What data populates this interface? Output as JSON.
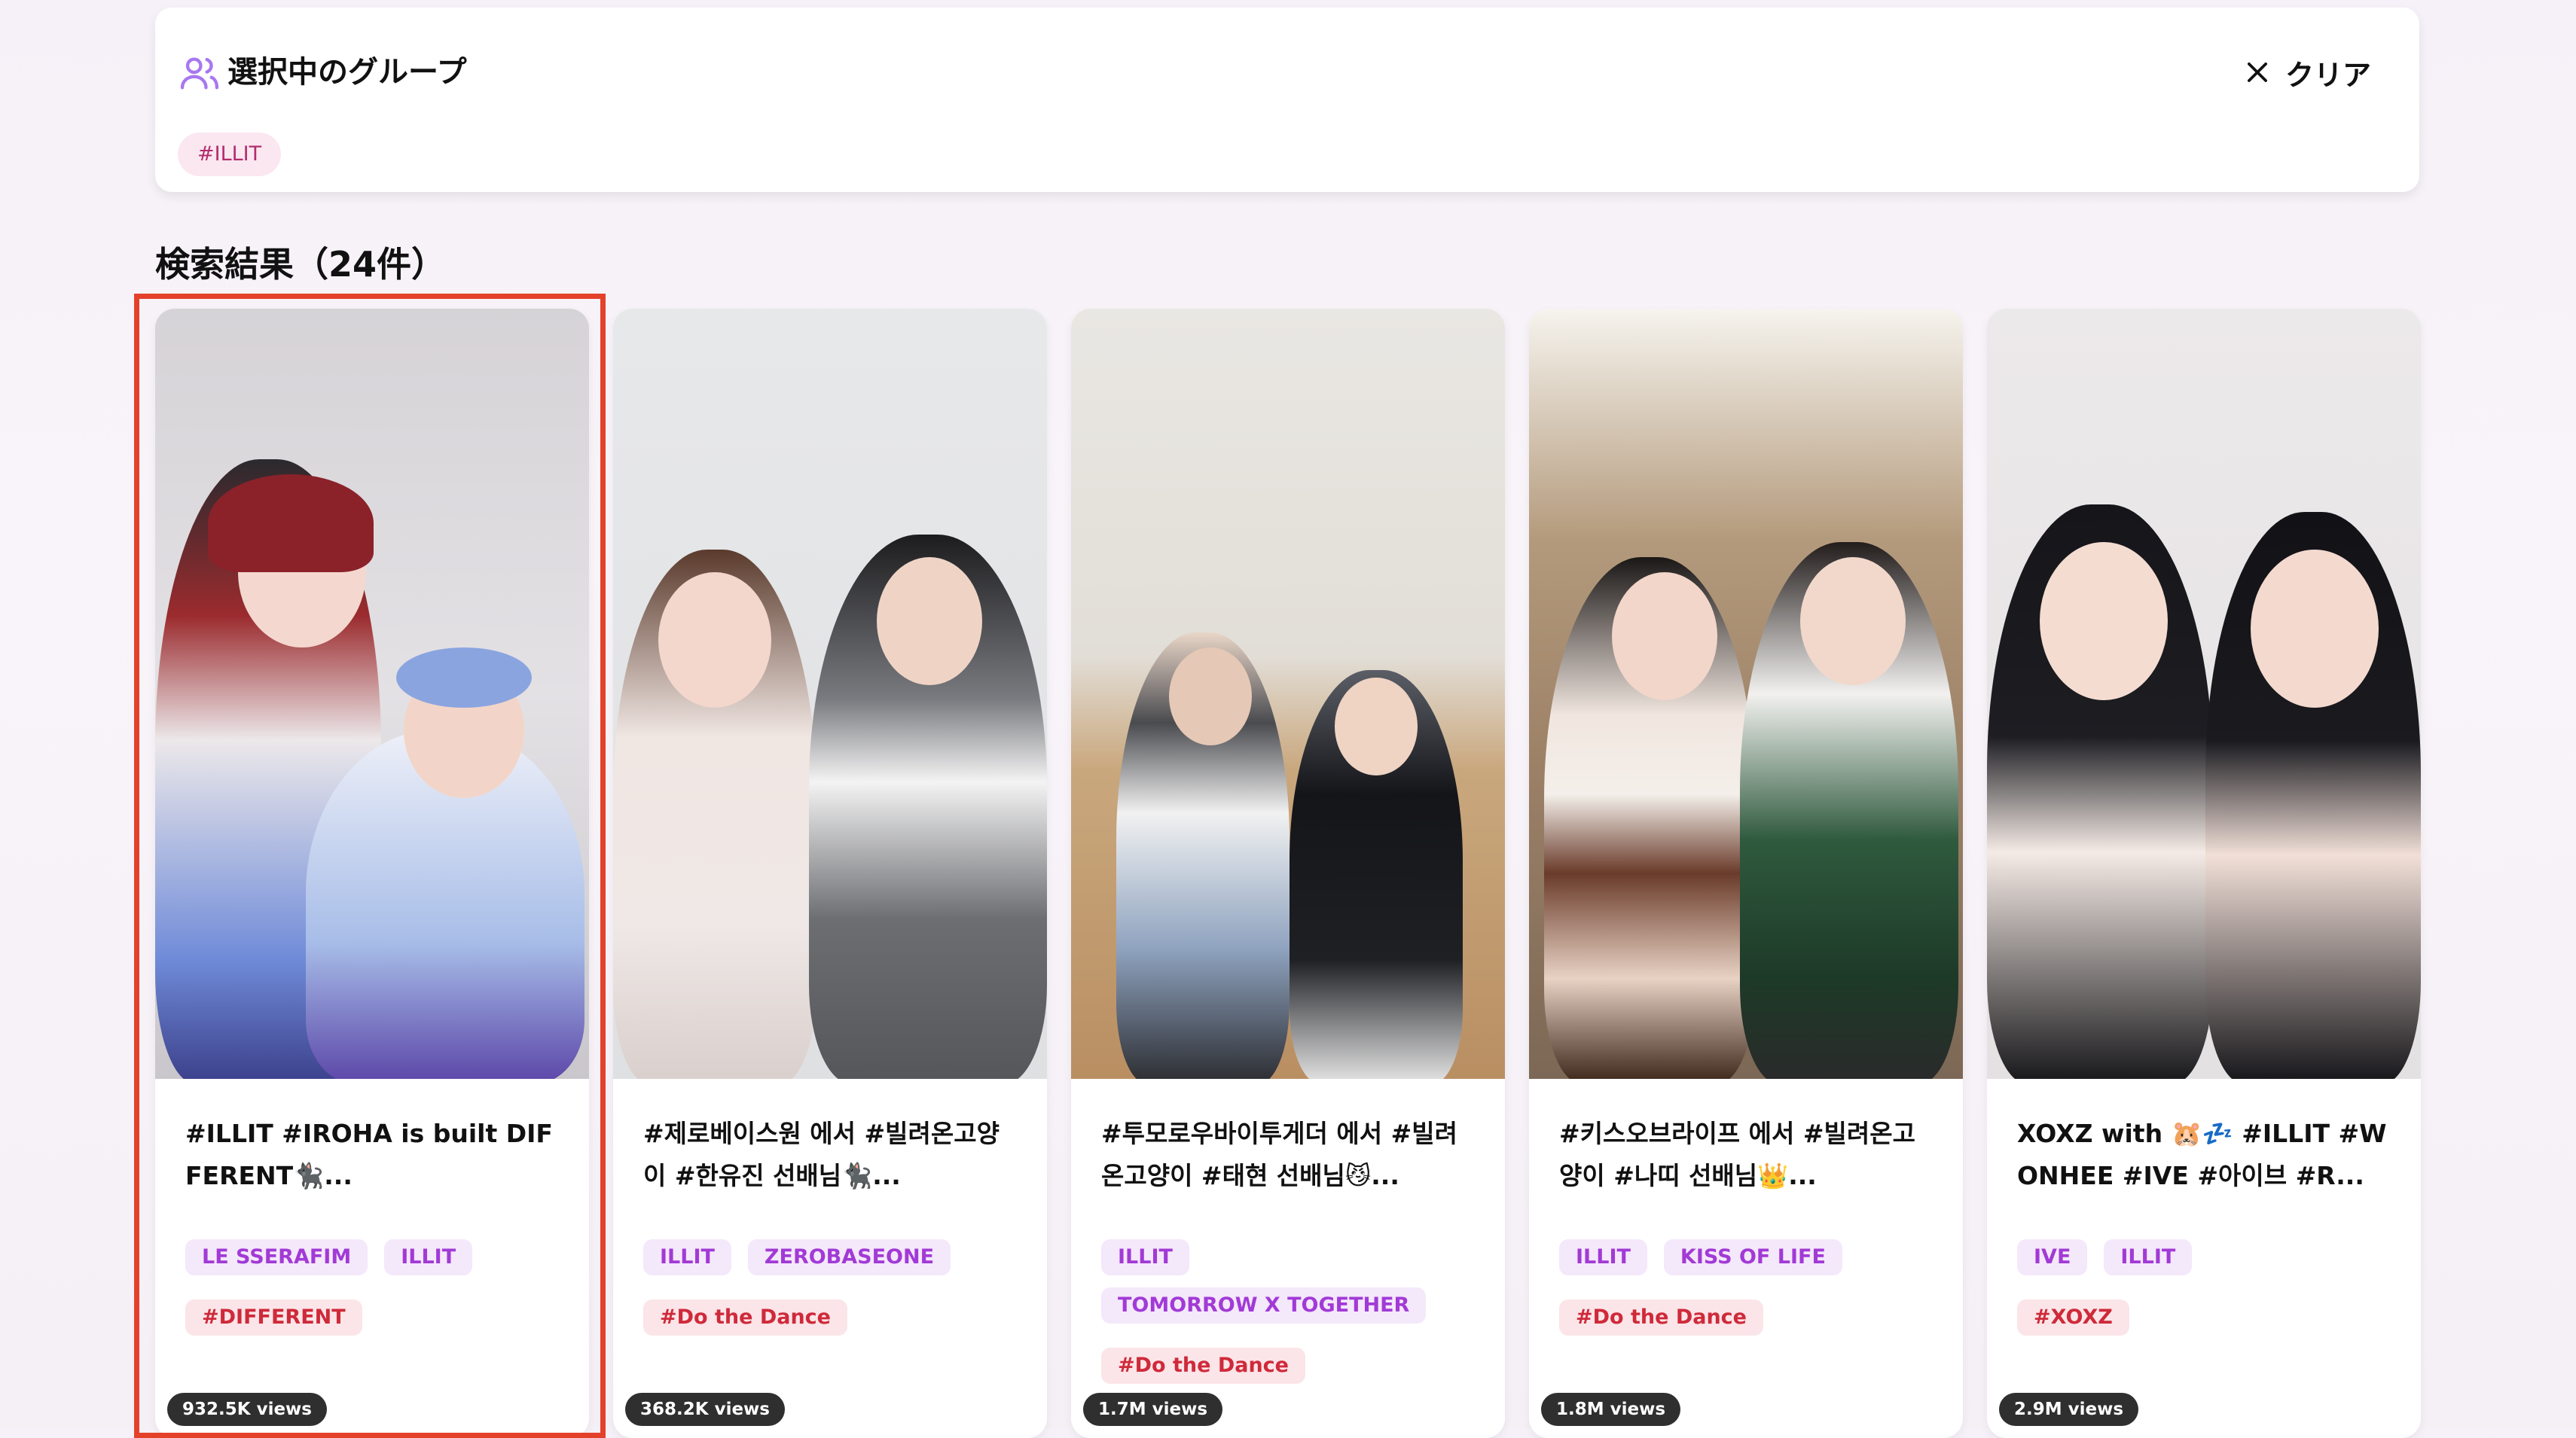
{
  "selected_group": {
    "title": "選択中のグループ",
    "clear_label": "クリア",
    "tag": "#ILLIT",
    "accent": "#a778f0"
  },
  "results": {
    "title": "検索結果（24件）"
  },
  "cards": [
    {
      "views": "932.5K views",
      "title": "#ILLIT #IROHA is built DIFFERENT🐈‍⬛...",
      "group_tags": [
        "LE SSERAFIM",
        "ILLIT"
      ],
      "hashtags": [
        "#DIFFERENT"
      ],
      "highlighted": true
    },
    {
      "views": "368.2K views",
      "title": "#제로베이스원 에서 #빌려온고양이 #한유진 선배님🐈‍⬛...",
      "group_tags": [
        "ILLIT",
        "ZEROBASEONE"
      ],
      "hashtags": [
        "#Do the Dance"
      ]
    },
    {
      "views": "1.7M views",
      "title": "#투모로우바이투게더 에서 #빌려온고양이 #태현 선배님😼...",
      "group_tags": [
        "ILLIT",
        "TOMORROW X TOGETHER"
      ],
      "hashtags": [
        "#Do the Dance"
      ]
    },
    {
      "views": "1.8M views",
      "title": "#키스오브라이프 에서 #빌려온고양이 #나띠 선배님👑...",
      "group_tags": [
        "ILLIT",
        "KISS OF LIFE"
      ],
      "hashtags": [
        "#Do the Dance"
      ]
    },
    {
      "views": "2.9M views",
      "title": "XOXZ with 🐹💤 #ILLIT #WONHEE #IVE #아이브 #R...",
      "group_tags": [
        "IVE",
        "ILLIT"
      ],
      "hashtags": [
        "#XOXZ"
      ]
    }
  ],
  "colors": {
    "group_tag_bg": "#f4e8fb",
    "group_tag_text": "#a23ad6",
    "hashtag_bg": "#fbe5e8",
    "hashtag_text": "#cf2a3a",
    "highlight_border": "#e4412b"
  }
}
